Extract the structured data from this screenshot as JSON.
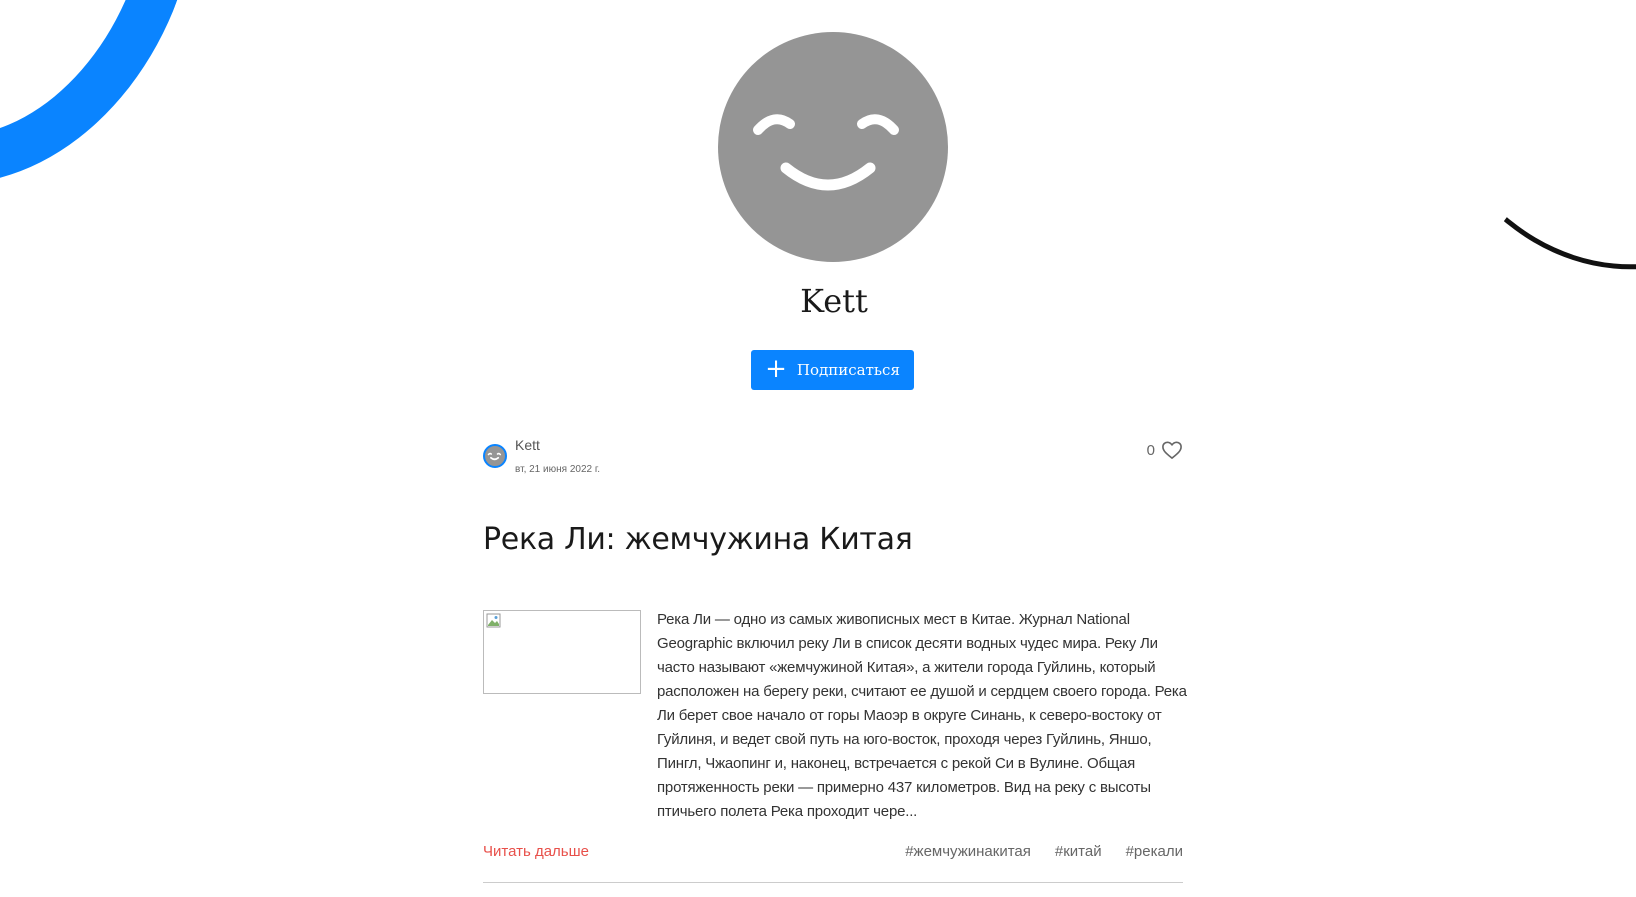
{
  "profile": {
    "name": "Kett",
    "follow_label": "Подписаться"
  },
  "post": {
    "author": "Kett",
    "date": "вт, 21 июня 2022 г.",
    "likes": "0",
    "title": "Река Ли: жемчужина Китая",
    "excerpt": "Река Ли — одно из самых живописных мест в Китае. Журнал National Geographic включил реку Ли в список десяти водных чудес мира. Реку Ли часто называют «жемчужиной Китая», а жители города Гуйлинь, который расположен на берегу реки, считают ее душой и сердцем своего города. Река Ли берет свое начало от горы Маоэр в округе Синань, к северо-востоку от Гуйлиня, и ведет свой путь на юго-восток, проходя через Гуйлинь, Яншо, Пингл, Чжаопинг и, наконец, встречается с рекой Си в Вулине. Общая протяженность реки — примерно 437 километров. Вид на реку с высоты птичьего полета Река проходит чере...",
    "read_more": "Читать дальше",
    "tags": [
      "#жемчужинакитая",
      "#китай",
      "#рекали"
    ]
  },
  "colors": {
    "accent": "#0a84ff",
    "read_more": "#e8504a",
    "avatar_gray": "#959595"
  },
  "icons": {
    "avatar": "smiley-face-icon",
    "follow": "plus-icon",
    "likes": "heart-icon",
    "thumbnail": "broken-image-icon"
  }
}
